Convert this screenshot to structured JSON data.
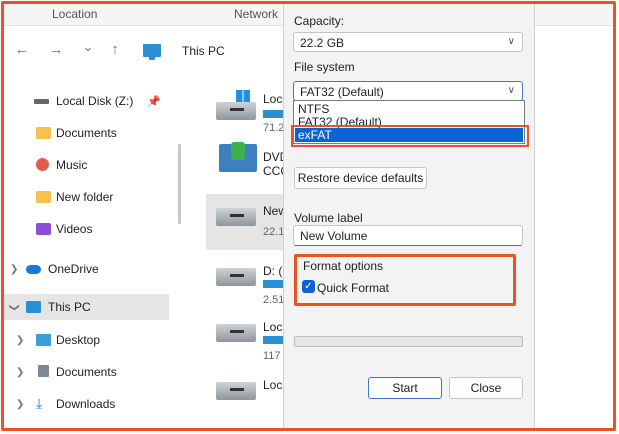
{
  "explorer": {
    "ribbon": {
      "location": "Location",
      "network": "Network"
    },
    "address": {
      "text": "This PC"
    },
    "nav": {
      "back": "←",
      "forward": "→",
      "down": "⌄",
      "up": "↑"
    },
    "sidebar": [
      {
        "label": "Local Disk (Z:)",
        "icon": "disk-icon",
        "pinned": true
      },
      {
        "label": "Documents",
        "icon": "folder-icon"
      },
      {
        "label": "Music",
        "icon": "music-icon"
      },
      {
        "label": "New folder",
        "icon": "folder-icon"
      },
      {
        "label": "Videos",
        "icon": "video-icon"
      },
      {
        "label": "OneDrive",
        "icon": "cloud-icon"
      },
      {
        "label": "This PC",
        "icon": "pc-icon"
      },
      {
        "label": "Desktop",
        "icon": "desktop-icon"
      },
      {
        "label": "Documents",
        "icon": "document-icon"
      },
      {
        "label": "Downloads",
        "icon": "download-icon"
      }
    ],
    "drives": [
      {
        "name": "Loc",
        "size": "71.2"
      },
      {
        "name": "DVD",
        "name2": "CCC"
      },
      {
        "name": "New",
        "size": "22.1"
      },
      {
        "name": "D: (",
        "size": "2.51"
      },
      {
        "name": "Loc",
        "size": "117"
      },
      {
        "name": "Loc"
      }
    ]
  },
  "dialog": {
    "capacity_label": "Capacity:",
    "capacity_value": "22.2 GB",
    "filesystem_label": "File system",
    "filesystem_value": "FAT32 (Default)",
    "filesystem_options": [
      "NTFS",
      "FAT32 (Default)",
      "exFAT"
    ],
    "filesystem_highlighted": "exFAT",
    "restore_button": "Restore device defaults",
    "volume_label": "Volume label",
    "volume_value": "New Volume",
    "format_options_label": "Format options",
    "quick_format_label": "Quick Format",
    "quick_format_checked": true,
    "start_button": "Start",
    "close_button": "Close"
  },
  "colors": {
    "highlight_frame": "#e8531f",
    "selection_blue": "#0a64d6"
  }
}
